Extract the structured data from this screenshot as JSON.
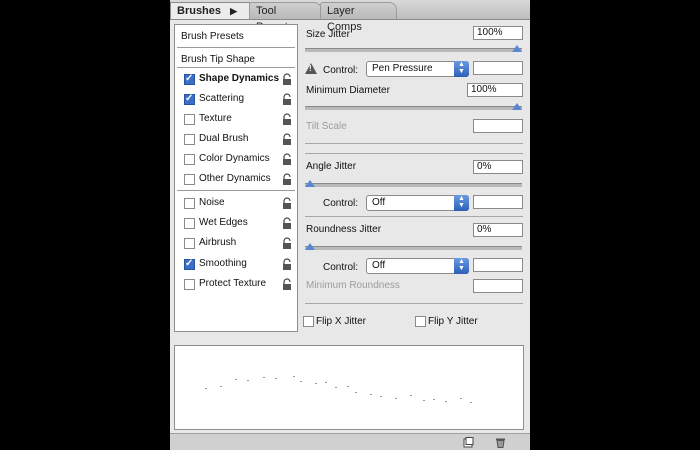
{
  "tabs": [
    {
      "label": "Brushes",
      "active": true
    },
    {
      "label": "Tool Presets",
      "active": false
    },
    {
      "label": "Layer Comps",
      "active": false
    }
  ],
  "leftlist": {
    "header": "Brush Presets",
    "tip_shape": "Brush Tip Shape",
    "items": [
      {
        "label": "Shape Dynamics",
        "checked": true,
        "selected": true
      },
      {
        "label": "Scattering",
        "checked": true,
        "selected": false
      },
      {
        "label": "Texture",
        "checked": false,
        "selected": false
      },
      {
        "label": "Dual Brush",
        "checked": false,
        "selected": false
      },
      {
        "label": "Color Dynamics",
        "checked": false,
        "selected": false
      },
      {
        "label": "Other Dynamics",
        "checked": false,
        "selected": false
      },
      {
        "label": "Noise",
        "checked": false,
        "selected": false
      },
      {
        "label": "Wet Edges",
        "checked": false,
        "selected": false
      },
      {
        "label": "Airbrush",
        "checked": false,
        "selected": false
      },
      {
        "label": "Smoothing",
        "checked": true,
        "selected": false
      },
      {
        "label": "Protect Texture",
        "checked": false,
        "selected": false
      }
    ]
  },
  "controls": {
    "size_jitter": {
      "label": "Size Jitter",
      "value": "100%",
      "slider": 1.0
    },
    "size_control": {
      "label": "Control:",
      "value": "Pen Pressure",
      "extra": ""
    },
    "min_diameter": {
      "label": "Minimum Diameter",
      "value": "100%",
      "slider": 1.0
    },
    "tilt_scale": {
      "label": "Tilt Scale",
      "value": ""
    },
    "angle_jitter": {
      "label": "Angle Jitter",
      "value": "0%",
      "slider": 0.0
    },
    "angle_control": {
      "label": "Control:",
      "value": "Off",
      "extra": ""
    },
    "roundness_jitter": {
      "label": "Roundness Jitter",
      "value": "0%",
      "slider": 0.0
    },
    "roundness_control": {
      "label": "Control:",
      "value": "Off",
      "extra": ""
    },
    "min_roundness": {
      "label": "Minimum Roundness",
      "value": ""
    },
    "flip_x": {
      "label": "Flip X Jitter",
      "checked": false
    },
    "flip_y": {
      "label": "Flip Y Jitter",
      "checked": false
    }
  },
  "icons": {
    "tab_menu": "triangle-right-icon",
    "warning": "warning-icon",
    "lock": "lock-icon",
    "new_preset": "new-brush-icon",
    "delete": "trash-icon"
  },
  "colors": {
    "accent": "#3a6fc8",
    "panel_bg": "#e8e8e8"
  }
}
